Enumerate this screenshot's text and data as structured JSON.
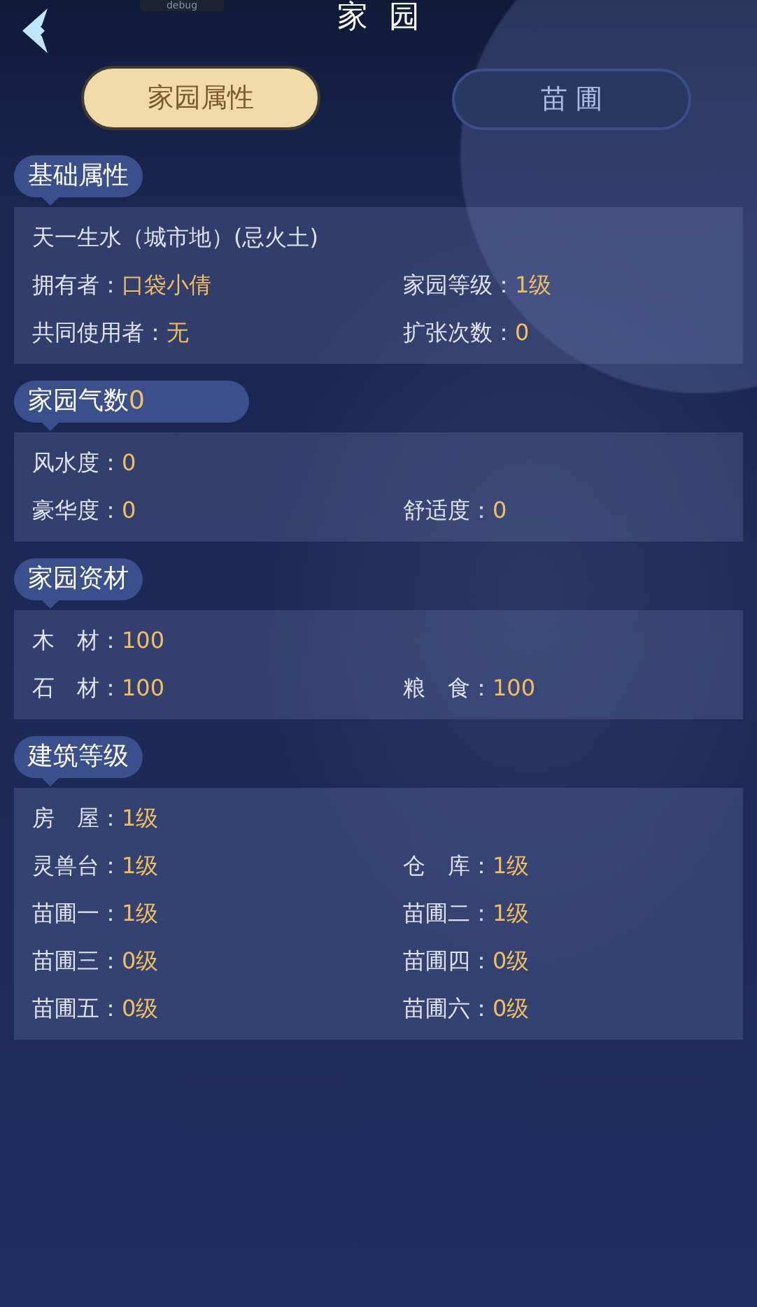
{
  "header": {
    "debug_tag": "debug",
    "title": "家 园"
  },
  "tabs": [
    {
      "label": "家园属性",
      "selected": true
    },
    {
      "label": "苗 圃",
      "selected": false
    }
  ],
  "sections": [
    {
      "title": "基础属性",
      "rows": [
        [
          {
            "kind": "text",
            "text": "天一生水（城市地）(忌火土)"
          }
        ],
        [
          {
            "kind": "pair",
            "label": "拥有者：",
            "value": "口袋小倩"
          },
          {
            "kind": "pair",
            "label": "家园等级：",
            "value": "1级"
          }
        ],
        [
          {
            "kind": "pair",
            "label": "共同使用者：",
            "value": "无"
          },
          {
            "kind": "pair",
            "label": "扩张次数：",
            "value": "0"
          }
        ]
      ]
    },
    {
      "title": "家园气数",
      "title_value": "0",
      "rows": [
        [
          {
            "kind": "pair",
            "label": "风水度：",
            "value": "0"
          }
        ],
        [
          {
            "kind": "pair",
            "label": "豪华度：",
            "value": "0"
          },
          {
            "kind": "pair",
            "label": "舒适度：",
            "value": "0"
          }
        ]
      ]
    },
    {
      "title": "家园资材",
      "rows": [
        [
          {
            "kind": "pair",
            "label": "木　材：",
            "value": "100"
          }
        ],
        [
          {
            "kind": "pair",
            "label": "石　材：",
            "value": "100"
          },
          {
            "kind": "pair",
            "label": "粮　食：",
            "value": "100"
          }
        ]
      ]
    },
    {
      "title": "建筑等级",
      "rows": [
        [
          {
            "kind": "pair",
            "label": "房　屋：",
            "value": "1级"
          }
        ],
        [
          {
            "kind": "pair",
            "label": "灵兽台：",
            "value": "1级"
          },
          {
            "kind": "pair",
            "label": "仓　库：",
            "value": "1级"
          }
        ],
        [
          {
            "kind": "pair",
            "label": "苗圃一：",
            "value": "1级"
          },
          {
            "kind": "pair",
            "label": "苗圃二：",
            "value": "1级"
          }
        ],
        [
          {
            "kind": "pair",
            "label": "苗圃三：",
            "value": "0级"
          },
          {
            "kind": "pair",
            "label": "苗圃四：",
            "value": "0级"
          }
        ],
        [
          {
            "kind": "pair",
            "label": "苗圃五：",
            "value": "0级"
          },
          {
            "kind": "pair",
            "label": "苗圃六：",
            "value": "0级"
          }
        ]
      ]
    }
  ]
}
